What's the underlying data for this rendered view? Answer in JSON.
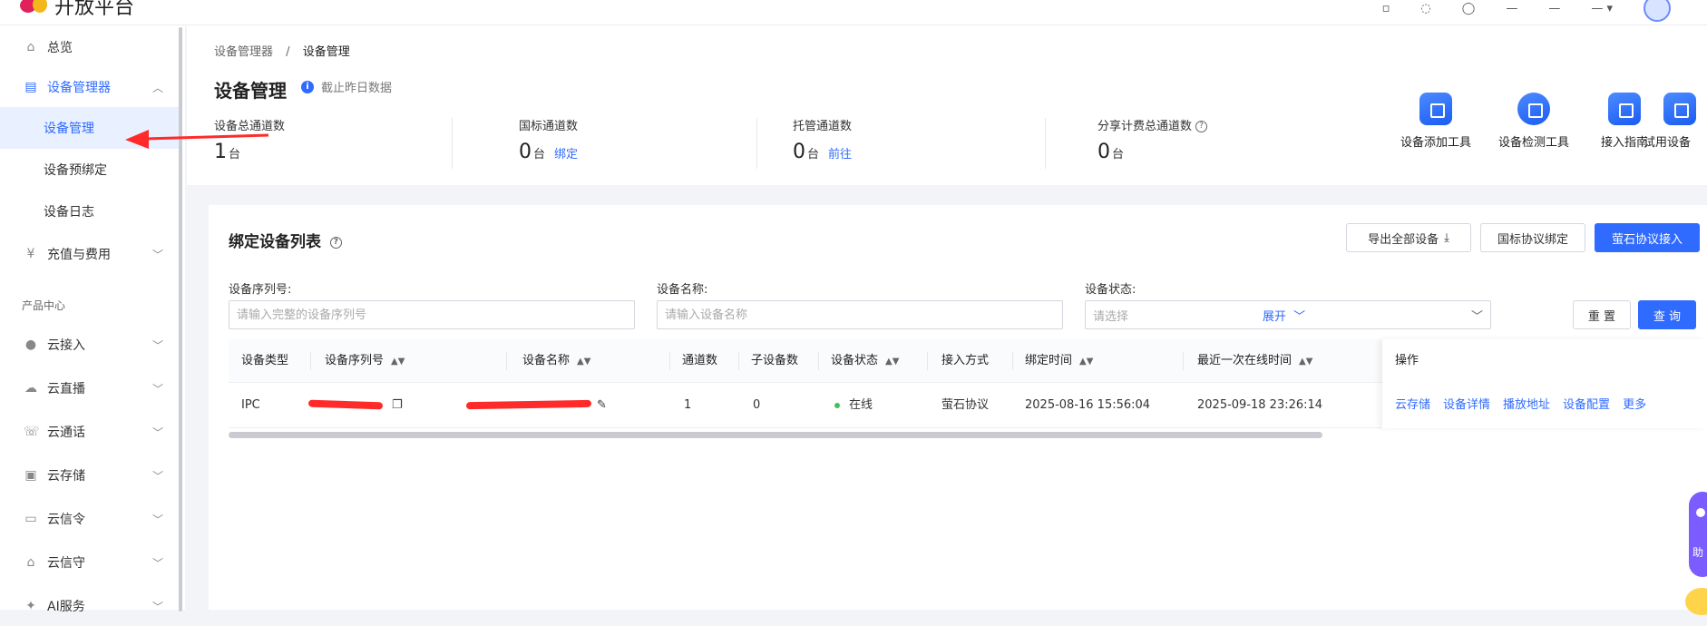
{
  "app": {
    "title": "开放平台"
  },
  "sidebar": {
    "overview": "总览",
    "device_manager": "设备管理器",
    "sub_items": [
      "设备管理",
      "设备预绑定",
      "设备日志"
    ],
    "billing": "充值与费用",
    "product_group": "产品中心",
    "products": [
      "云接入",
      "云直播",
      "云通话",
      "云存储",
      "云信令",
      "云信守",
      "AI服务"
    ]
  },
  "breadcrumb": {
    "parent": "设备管理器",
    "sep": "/",
    "current": "设备管理"
  },
  "page": {
    "title": "设备管理",
    "note": "截止昨日数据"
  },
  "stats": [
    {
      "label": "设备总通道数",
      "value": "1",
      "unit": "台",
      "link": ""
    },
    {
      "label": "国标通道数",
      "value": "0",
      "unit": "台",
      "link": "绑定"
    },
    {
      "label": "托管通道数",
      "value": "0",
      "unit": "台",
      "link": "前往"
    },
    {
      "label": "分享计费总通道数",
      "value": "0",
      "unit": "台",
      "link": ""
    }
  ],
  "tools": [
    "设备添加工具",
    "设备检测工具",
    "接入指南",
    "试用设备"
  ],
  "list": {
    "title": "绑定设备列表",
    "buttons": {
      "export": "导出全部设备",
      "gb_bind": "国标协议绑定",
      "ezviz_access": "萤石协议接入"
    },
    "filters": {
      "serial_label": "设备序列号:",
      "serial_placeholder": "请输入完整的设备序列号",
      "name_label": "设备名称:",
      "name_placeholder": "请输入设备名称",
      "status_label": "设备状态:",
      "status_placeholder": "请选择",
      "expand": "展开",
      "reset": "重 置",
      "query": "查 询"
    },
    "columns": [
      "设备类型",
      "设备序列号",
      "设备名称",
      "通道数",
      "子设备数",
      "设备状态",
      "接入方式",
      "绑定时间",
      "最近一次在线时间",
      "操作"
    ],
    "rows": [
      {
        "type": "IPC",
        "channels": "1",
        "sub_devices": "0",
        "status": "在线",
        "access": "萤石协议",
        "bind_time": "2025-08-16 15:56:04",
        "last_online": "2025-09-18 23:26:14",
        "actions": [
          "云存储",
          "设备详情",
          "播放地址",
          "设备配置",
          "更多"
        ]
      }
    ]
  },
  "colors": {
    "accent": "#2f6bff",
    "online": "#3fc35d",
    "annotation": "#ff2a2a"
  }
}
